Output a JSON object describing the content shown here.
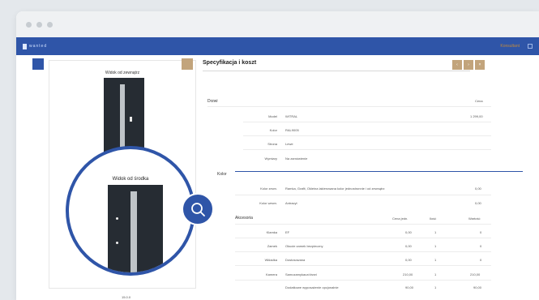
{
  "app": {
    "brand": "wanted",
    "user": "Konsultant"
  },
  "panel": {
    "outside_label": "Widok od zewnątrz",
    "inside_label": "Widok od środka",
    "bottom_label": "15.0.0"
  },
  "spec": {
    "title": "Specyfikacja i koszt",
    "buttons": [
      "‹",
      "›",
      "×"
    ],
    "door_section": "Drzwi",
    "door_value_header": "Cena",
    "door_rows": [
      {
        "label": "Model",
        "value": "WITRAL"
      },
      {
        "label": "Kolor",
        "value": "RAL9005"
      },
      {
        "label": "Strona",
        "value": "Lewe"
      },
      {
        "label": "Wymiary",
        "value": "Na zamówienie"
      }
    ],
    "door_price": "1 299,00",
    "color_section": "Kolor",
    "color_rows": [
      {
        "label": "Kolor zewn.",
        "value": "Ramka, Grafit, Okleina lakierowana kolor jednostronnie i od zewnątrz",
        "price": "0,00"
      },
      {
        "label": "Kolor wewn.",
        "value": "Antracyt",
        "price": "0,00"
      }
    ],
    "parts_section": "Akcesoria",
    "parts_headers": [
      "Cena jedn.",
      "Ilość",
      "Wartość"
    ],
    "parts_rows": [
      {
        "label": "Klamka",
        "value": "EF",
        "unit": "0,00",
        "qty": "1",
        "total": "0"
      },
      {
        "label": "Zamek",
        "value": "Okucie zamek bezpieczny",
        "unit": "0,00",
        "qty": "1",
        "total": "0"
      },
      {
        "label": "Wkładka",
        "value": "Dostosowana",
        "unit": "0,00",
        "qty": "1",
        "total": "0"
      },
      {
        "label": "Kamera",
        "value": "Samozamykacz/drzwi",
        "unit": "210,00",
        "qty": "1",
        "total": "210,00"
      },
      {
        "label": "",
        "value": "Dodatkowe wyposażenie opcjonalnie",
        "unit": "90,00",
        "qty": "1",
        "total": "90,00"
      }
    ]
  },
  "colors": {
    "primary": "#2f55a8",
    "accent": "#c2a47c"
  }
}
